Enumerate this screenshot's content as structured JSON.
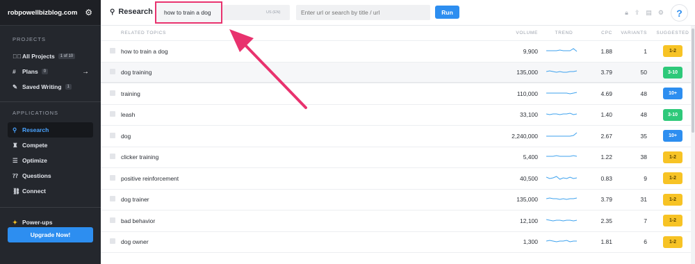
{
  "sidebar": {
    "brand": "robpowellbizblog.com",
    "sections": {
      "projects_title": "PROJECTS",
      "applications_title": "APPLICATIONS"
    },
    "projects": [
      {
        "label": "All Projects",
        "badge": "1 of 10",
        "icon": "projects-icon"
      },
      {
        "label": "Plans",
        "badge": "0",
        "icon": "hash-icon"
      },
      {
        "label": "Saved Writing",
        "badge": "1",
        "icon": "edit-icon"
      }
    ],
    "applications": [
      {
        "label": "Research",
        "icon": "search-icon",
        "active": true
      },
      {
        "label": "Compete",
        "icon": "trophy-icon"
      },
      {
        "label": "Optimize",
        "icon": "sliders-icon"
      },
      {
        "label": "Questions",
        "icon": "question-list-icon"
      },
      {
        "label": "Connect",
        "icon": "link-icon"
      }
    ],
    "power_ups": "Power-ups",
    "upgrade": "Upgrade Now!"
  },
  "topbar": {
    "title": "Research",
    "query": "how to train a dog",
    "country": "US (EN)",
    "url_placeholder": "Enter url or search by title / url",
    "run": "Run",
    "help": "?"
  },
  "table": {
    "headers": {
      "topic": "RELATED TOPICS",
      "volume": "VOLUME",
      "trend": "TREND",
      "cpc": "CPC",
      "variants": "VARIANTS",
      "suggested": "SUGGESTED"
    },
    "rows": [
      {
        "topic": "how to train a dog",
        "volume": "9,900",
        "cpc": "1.88",
        "variants": "1",
        "suggested": "1-2",
        "trend": [
          5,
          5,
          5,
          5,
          4,
          5,
          5,
          5,
          2,
          6
        ]
      },
      {
        "topic": "dog training",
        "volume": "135,000",
        "cpc": "3.79",
        "variants": "50",
        "suggested": "3-10",
        "trend": [
          5,
          4,
          5,
          6,
          5,
          6,
          6,
          5,
          5,
          4
        ]
      },
      {
        "topic": "training",
        "volume": "110,000",
        "cpc": "4.69",
        "variants": "48",
        "suggested": "10+",
        "trend": [
          5,
          5,
          5,
          5,
          5,
          5,
          5,
          6,
          5,
          4
        ]
      },
      {
        "topic": "leash",
        "volume": "33,100",
        "cpc": "1.40",
        "variants": "48",
        "suggested": "3-10",
        "trend": [
          5,
          6,
          5,
          5,
          6,
          5,
          5,
          4,
          6,
          5
        ]
      },
      {
        "topic": "dog",
        "volume": "2,240,000",
        "cpc": "2.67",
        "variants": "35",
        "suggested": "10+",
        "trend": [
          6,
          6,
          6,
          6,
          6,
          6,
          6,
          6,
          5,
          1
        ]
      },
      {
        "topic": "clicker training",
        "volume": "5,400",
        "cpc": "1.22",
        "variants": "38",
        "suggested": "1-2",
        "trend": [
          5,
          5,
          5,
          4,
          5,
          5,
          5,
          5,
          4,
          5
        ]
      },
      {
        "topic": "positive reinforcement",
        "volume": "40,500",
        "cpc": "0.83",
        "variants": "9",
        "suggested": "1-2",
        "trend": [
          4,
          6,
          5,
          3,
          7,
          5,
          6,
          4,
          6,
          5
        ]
      },
      {
        "topic": "dog trainer",
        "volume": "135,000",
        "cpc": "3.79",
        "variants": "31",
        "suggested": "1-2",
        "trend": [
          5,
          4,
          5,
          5,
          6,
          5,
          6,
          5,
          5,
          4
        ]
      },
      {
        "topic": "bad behavior",
        "volume": "12,100",
        "cpc": "2.35",
        "variants": "7",
        "suggested": "1-2",
        "trend": [
          4,
          5,
          6,
          5,
          5,
          6,
          5,
          5,
          6,
          5
        ]
      },
      {
        "topic": "dog owner",
        "volume": "1,300",
        "cpc": "1.81",
        "variants": "6",
        "suggested": "1-2",
        "trend": [
          5,
          4,
          5,
          6,
          5,
          5,
          4,
          6,
          5,
          5
        ]
      }
    ]
  },
  "colors": {
    "badge_1_2": "#f7c325",
    "badge_3_10": "#2ec97a",
    "badge_10_plus": "#2d8ef0",
    "accent": "#2d8ef0",
    "annotation": "#e8326e",
    "trend_line": "#3ea2ee"
  }
}
